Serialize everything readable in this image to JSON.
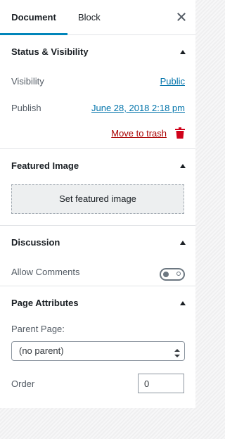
{
  "tabs": {
    "document": "Document",
    "block": "Block"
  },
  "status_panel": {
    "title": "Status & Visibility",
    "visibility_label": "Visibility",
    "visibility_value": "Public",
    "publish_label": "Publish",
    "publish_value": "June 28, 2018 2:18 pm",
    "trash_label": "Move to trash"
  },
  "featured_panel": {
    "title": "Featured Image",
    "button_label": "Set featured image"
  },
  "discussion_panel": {
    "title": "Discussion",
    "allow_comments_label": "Allow Comments",
    "allow_comments_enabled": false
  },
  "attributes_panel": {
    "title": "Page Attributes",
    "parent_label": "Parent Page:",
    "parent_value": "(no parent)",
    "order_label": "Order",
    "order_value": "0"
  },
  "colors": {
    "accent": "#0085ba",
    "link": "#0073aa",
    "danger": "#a00"
  }
}
